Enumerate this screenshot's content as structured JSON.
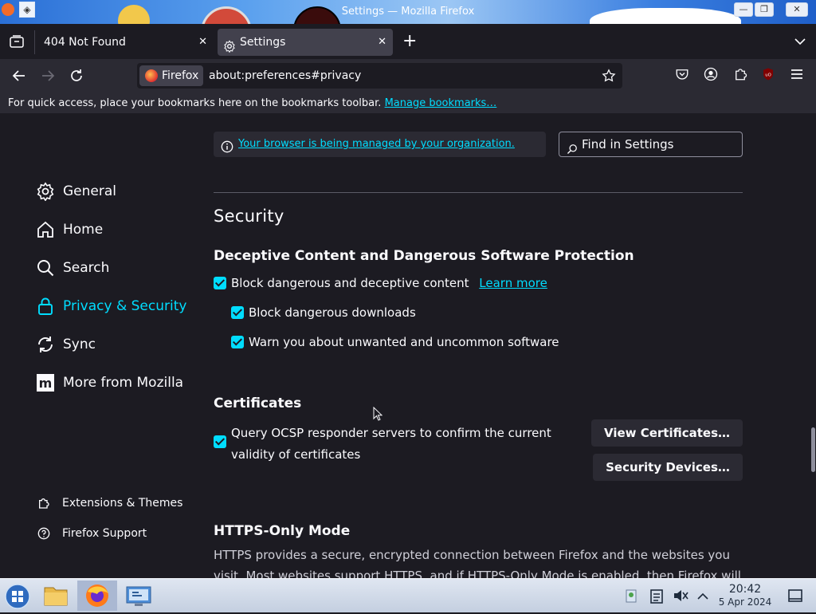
{
  "window": {
    "title": "Settings — Mozilla Firefox",
    "minimize_label": "—",
    "maximize_label": "❐",
    "close_label": "✕"
  },
  "tabs": [
    {
      "label": "404 Not Found",
      "active": false
    },
    {
      "label": "Settings",
      "active": true
    }
  ],
  "tab_actions": {
    "new_tab_label": "+",
    "list_all_label": "⌄"
  },
  "navbar": {
    "identity_label": "Firefox",
    "url": "about:preferences#privacy"
  },
  "bookmarks_bar": {
    "message": "For quick access, place your bookmarks here on the bookmarks toolbar.",
    "manage_link": "Manage bookmarks…"
  },
  "sidebar": {
    "categories": [
      {
        "label": "General",
        "icon": "gear-icon",
        "selected": false
      },
      {
        "label": "Home",
        "icon": "home-icon",
        "selected": false
      },
      {
        "label": "Search",
        "icon": "search-icon",
        "selected": false
      },
      {
        "label": "Privacy & Security",
        "icon": "lock-icon",
        "selected": true
      },
      {
        "label": "Sync",
        "icon": "sync-icon",
        "selected": false
      },
      {
        "label": "More from Mozilla",
        "icon": "mozilla-icon",
        "selected": false
      }
    ],
    "footer": [
      {
        "label": "Extensions & Themes",
        "icon": "puzzle-icon"
      },
      {
        "label": "Firefox Support",
        "icon": "help-icon"
      }
    ]
  },
  "policy_notice": {
    "link": "Your browser is being managed by your organization."
  },
  "search": {
    "placeholder": "Find in Settings"
  },
  "security": {
    "heading": "Security",
    "deceptive": {
      "heading": "Deceptive Content and Dangerous Software Protection",
      "block_label": "Block dangerous and deceptive content",
      "learn_more": "Learn more",
      "downloads_label": "Block dangerous downloads",
      "uncommon_label": "Warn you about unwanted and uncommon software"
    },
    "certificates": {
      "heading": "Certificates",
      "ocsp_line1": "Query OCSP responder servers to confirm the current",
      "ocsp_line2": "validity of certificates",
      "view_button": "View Certificates…",
      "devices_button": "Security Devices…"
    },
    "https_only": {
      "heading": "HTTPS-Only Mode",
      "desc": "HTTPS provides a secure, encrypted connection between Firefox and the websites you visit. Most websites support HTTPS, and if HTTPS-Only Mode is enabled, then Firefox will"
    }
  },
  "taskbar": {
    "time": "20:42",
    "date": "5 Apr 2024"
  },
  "colors": {
    "accent": "#00ddff",
    "background": "#1c1b22",
    "toolbar": "#2b2a33"
  }
}
